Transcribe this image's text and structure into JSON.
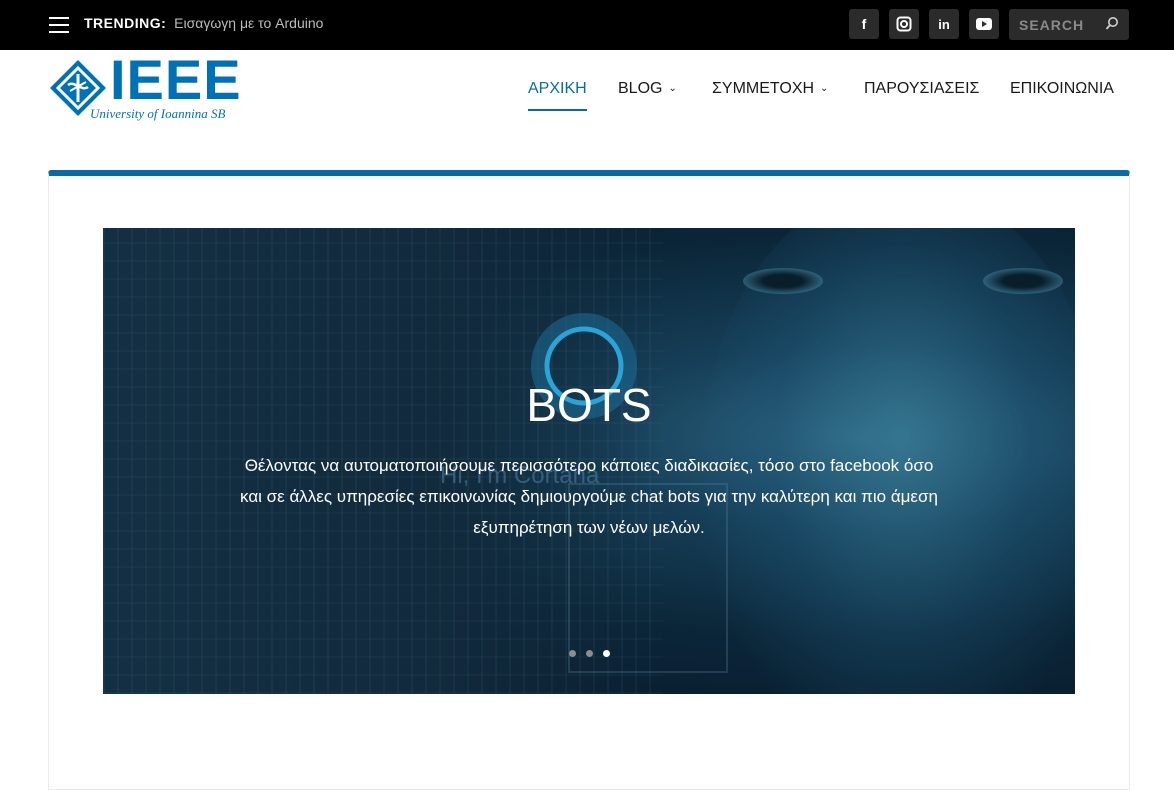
{
  "topbar": {
    "trending_label": "TRENDING:",
    "trending_link": "Εισαγωγη με το Arduino",
    "social": [
      {
        "icon": "facebook-icon",
        "glyph": "f"
      },
      {
        "icon": "instagram-icon",
        "glyph": "◙"
      },
      {
        "icon": "linkedin-icon",
        "glyph": "in"
      },
      {
        "icon": "youtube-icon",
        "glyph": "▶"
      }
    ],
    "search_placeholder": "SEARCH"
  },
  "logo": {
    "text": "IEEE",
    "subtitle": "University of Ioannina SB"
  },
  "nav": {
    "items": [
      {
        "label": "ΑΡΧΙΚΗ",
        "active": true,
        "dropdown": false
      },
      {
        "label": "BLOG",
        "active": false,
        "dropdown": true
      },
      {
        "label": "ΣΥΜΜΕΤΟΧΗ",
        "active": false,
        "dropdown": true
      },
      {
        "label": "ΠΑΡΟΥΣΙΑΣΕΙΣ",
        "active": false,
        "dropdown": false
      },
      {
        "label": "ΕΠΙΚΟΙΝΩΝΙΑ",
        "active": false,
        "dropdown": false
      }
    ]
  },
  "slider": {
    "title": "BOTS",
    "description": "Θέλοντας να αυτοματοποιήσουμε περισσότερο κάποιες διαδικασίες, τόσο στο facebook όσο και σε άλλες υπηρεσίες επικοινωνίας δημιουργούμε chat bots για την καλύτερη και πιο άμεση εξυπηρέτηση των νέων μελών.",
    "image_text": "Hi, I'm Cortana",
    "slide_count": 3,
    "active_slide": 3
  },
  "colors": {
    "accent": "#0a6aa8",
    "topbar_bg": "#000000",
    "logo_blue": "#0071b5"
  }
}
